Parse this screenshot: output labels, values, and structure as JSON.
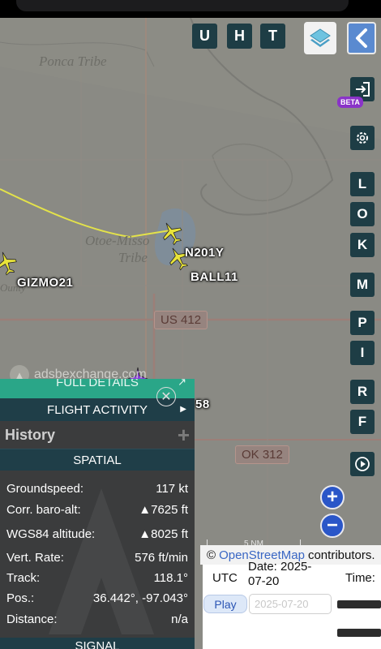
{
  "top_buttons": [
    "U",
    "H",
    "T"
  ],
  "side_buttons": [
    "L",
    "O",
    "K",
    "M",
    "P",
    "I",
    "R",
    "F"
  ],
  "beta_badge": "BETA",
  "map_labels": {
    "ponca": "Ponca Tribe",
    "otoe": "Otoe-Misso",
    "tribe": "Tribe",
    "county": "Ounty"
  },
  "callsigns": {
    "n201y": "N201Y",
    "ball11": "BALL11",
    "gizmo21": "GIZMO21",
    "partial": "58"
  },
  "highways": {
    "us412": "US 412",
    "ok312": "OK 312"
  },
  "watermark": "adsbexchange.com",
  "panel": {
    "full_details": "FULL DETAILS",
    "flight_activity": "FLIGHT ACTIVITY",
    "history": "History",
    "spatial": "SPATIAL",
    "signal": "SIGNAL",
    "rows": [
      {
        "label": "Groundspeed:",
        "value": "117",
        "unit": "kt"
      },
      {
        "label": "Corr. baro-alt:",
        "value": "7625",
        "unit": "ft",
        "arrow": "▲"
      },
      {
        "label": "WGS84 altitude:",
        "value": "8025",
        "unit": "ft",
        "arrow": "▲"
      },
      {
        "label": "Vert. Rate:",
        "value": "576",
        "unit": "ft/min"
      },
      {
        "label": "Track:",
        "value": "118.1°",
        "unit": ""
      },
      {
        "label": "Pos.:",
        "value": "36.442°, -97.043°",
        "unit": ""
      },
      {
        "label": "Distance:",
        "value": "n/a",
        "unit": ""
      }
    ]
  },
  "map_footer": {
    "scale": "5 NM",
    "attribution_prefix": "©",
    "attribution_link": "OpenStreetMap",
    "attribution_suffix": "contributors."
  },
  "time_panel": {
    "utc": "UTC",
    "date_label": "Date: 2025-07-20",
    "time_label": "Time:",
    "play": "Play",
    "date_input": "2025-07-20"
  },
  "colors": {
    "accent_teal": "#2aa688",
    "dark_button": "#1e3d45",
    "aircraft_yellow": "#e8e33a",
    "track_line": "#e3e24a"
  }
}
